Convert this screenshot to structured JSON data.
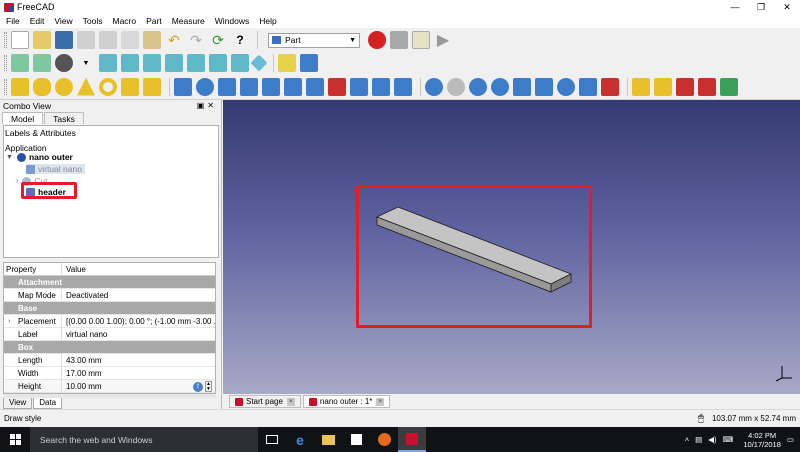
{
  "window": {
    "title": "FreeCAD",
    "controls": [
      "—",
      "❐",
      "✕"
    ]
  },
  "menu": [
    "File",
    "Edit",
    "View",
    "Tools",
    "Macro",
    "Part",
    "Measure",
    "Windows",
    "Help"
  ],
  "workbench": {
    "selected": "Part"
  },
  "combo_view": {
    "title": "Combo View",
    "tabs": [
      "Model",
      "Tasks"
    ],
    "tree": {
      "header": "Labels & Attributes",
      "application": "Application",
      "items": [
        {
          "label": "nano outer",
          "bold": true,
          "level": 0
        },
        {
          "label": "virtual nano",
          "level": 1,
          "highlighted": true
        },
        {
          "label": "Cut",
          "level": 1,
          "dim": true
        },
        {
          "label": "header",
          "level": 1,
          "bold": true
        }
      ]
    },
    "properties": {
      "columns": [
        "Property",
        "Value"
      ],
      "rows": [
        {
          "group": "Attachment"
        },
        {
          "key": "Map Mode",
          "value": "Deactivated"
        },
        {
          "group": "Base"
        },
        {
          "key": "Placement",
          "value": "[(0.00 0.00 1.00); 0.00 °; (-1.00 mm  -3.00 ...",
          "expandable": true
        },
        {
          "key": "Label",
          "value": "virtual nano"
        },
        {
          "group": "Box"
        },
        {
          "key": "Length",
          "value": "43.00 mm"
        },
        {
          "key": "Width",
          "value": "17.00 mm"
        },
        {
          "key": "Height",
          "value": "10.00 mm",
          "editing": true
        }
      ]
    },
    "bottom_tabs": [
      "View",
      "Data"
    ]
  },
  "doc_tabs": [
    {
      "label": "Start page"
    },
    {
      "label": "nano outer : 1*",
      "active": true
    }
  ],
  "status": {
    "left": "Draw style",
    "dimensions": "103.07 mm x 52.74 mm"
  },
  "taskbar": {
    "search_placeholder": "Search the web and Windows",
    "time": "4:02 PM",
    "date": "10/17/2018"
  },
  "colors": {
    "highlight_red": "#e41d25",
    "view_top": "#343a72",
    "view_bottom": "#a7a9c7",
    "group_row": "#a8a8a8"
  }
}
